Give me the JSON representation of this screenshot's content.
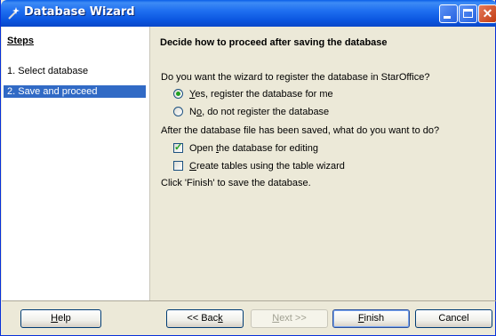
{
  "window": {
    "title": "Database Wizard"
  },
  "steps": {
    "header": "Steps",
    "items": [
      {
        "label": "1.  Select database"
      },
      {
        "label": "2.  Save and proceed"
      }
    ]
  },
  "content": {
    "title": "Decide how to proceed after saving the database",
    "register_question": "Do you want the wizard to register the database in StarOffice?",
    "register_yes": {
      "u": "Y",
      "rest": "es, register the database for me"
    },
    "register_no": {
      "pre": "N",
      "u": "o",
      "rest": ", do not register the database"
    },
    "after_question": "After the database file has been saved, what do you want to do?",
    "open_for_editing": {
      "pre": "Open ",
      "u": "t",
      "rest": "he database for editing"
    },
    "create_tables": {
      "u": "C",
      "rest": "reate tables using the table wizard"
    },
    "finish_note": "Click 'Finish' to save the database."
  },
  "buttons": {
    "help": {
      "u": "H",
      "rest": "elp"
    },
    "back": {
      "pre": "<< Bac",
      "u": "k"
    },
    "next": {
      "u": "N",
      "rest": "ext >>"
    },
    "finish": {
      "u": "F",
      "rest": "inish"
    },
    "cancel": "Cancel"
  },
  "state": {
    "register_selected": "yes",
    "open_for_editing_checked": true,
    "create_tables_checked": false,
    "next_enabled": false
  }
}
